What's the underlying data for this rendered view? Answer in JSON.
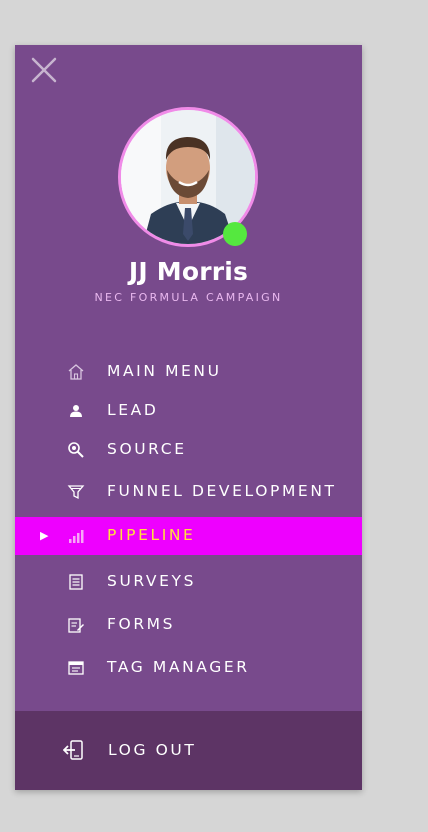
{
  "profile": {
    "name": "JJ Morris",
    "subtitle": "NEC FORMULA CAMPAIGN",
    "status": "online"
  },
  "menu": {
    "items": [
      {
        "label": "MAIN MENU",
        "icon": "home-icon"
      },
      {
        "label": "LEAD",
        "icon": "user-icon"
      },
      {
        "label": "SOURCE",
        "icon": "search-icon"
      },
      {
        "label": "FUNNEL DEVELOPMENT",
        "icon": "funnel-icon"
      },
      {
        "label": "PIPELINE",
        "icon": "bar-chart-icon",
        "active": true
      },
      {
        "label": "SURVEYS",
        "icon": "document-icon"
      },
      {
        "label": "FORMS",
        "icon": "form-edit-icon"
      },
      {
        "label": "TAG MANAGER",
        "icon": "browser-window-icon"
      }
    ]
  },
  "logout": {
    "label": "LOG OUT",
    "icon": "logout-icon"
  },
  "colors": {
    "drawer_bg": "#784a8c",
    "active_bg": "#ee00ff",
    "active_text": "#ffe23c",
    "footer_bg": "#5d3465",
    "avatar_ring": "#f08be8",
    "status_online": "#55e83f"
  }
}
